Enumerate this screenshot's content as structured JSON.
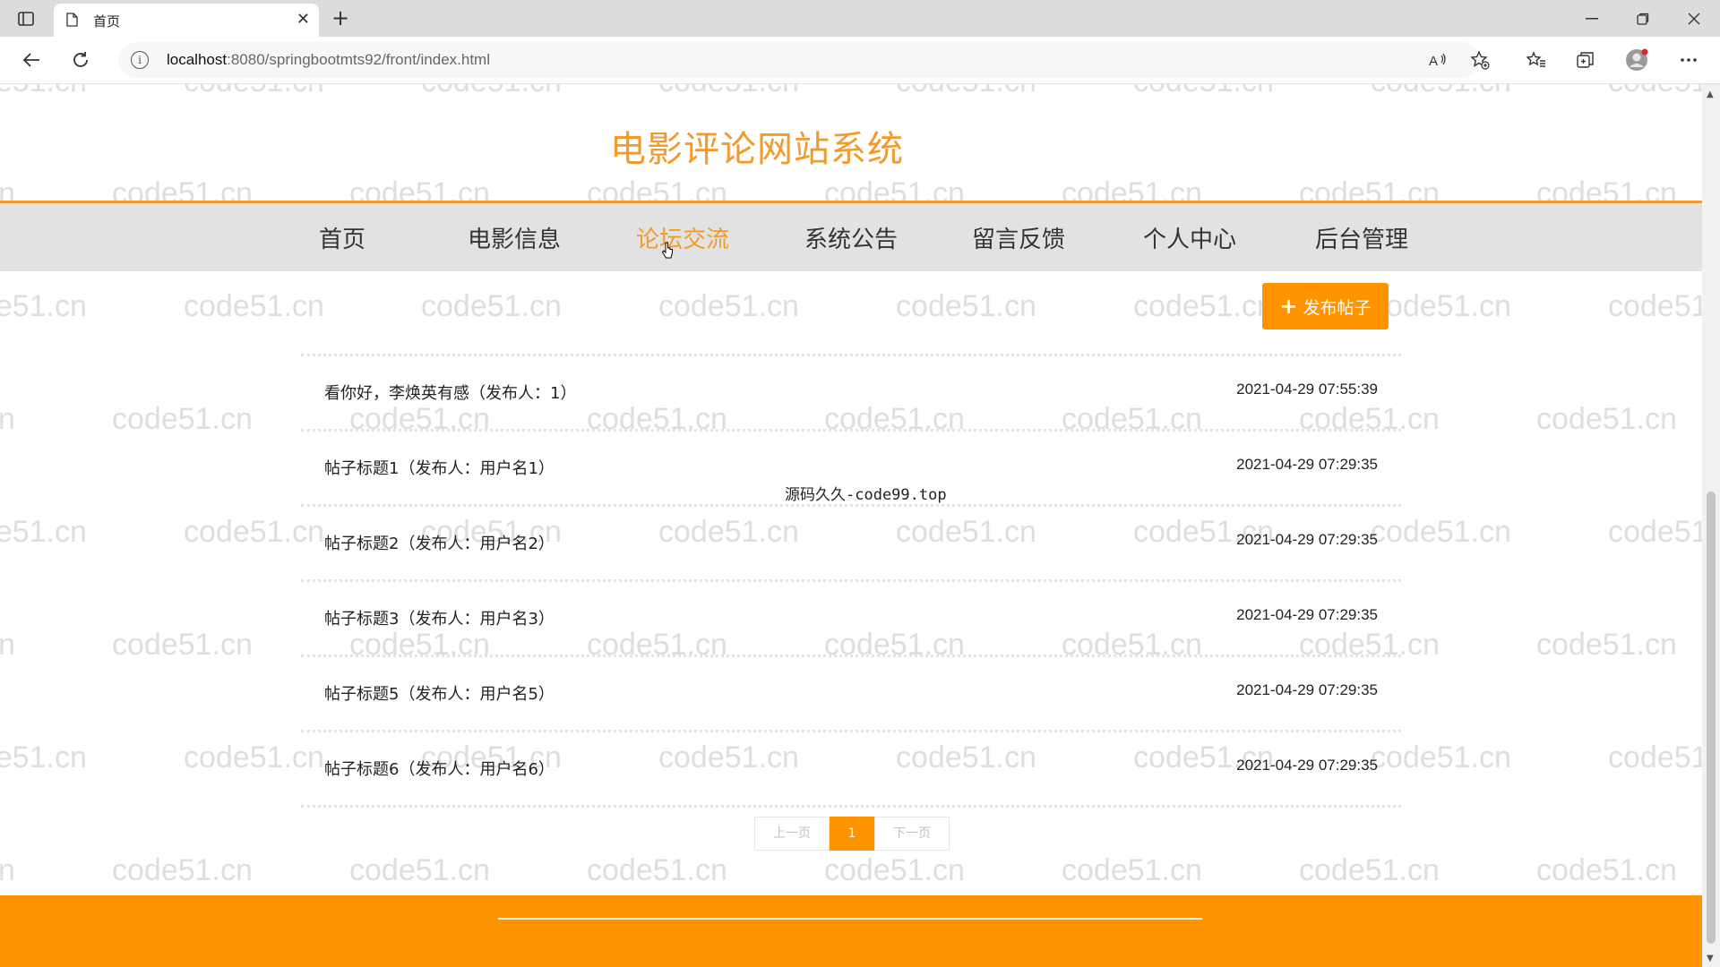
{
  "browser": {
    "tab_title": "首页",
    "url_host": "localhost",
    "url_rest": ":8080/springbootmts92/front/index.html"
  },
  "page": {
    "site_title": "电影评论网站系统",
    "watermark_text": "code51.cn",
    "nav": [
      {
        "label": "首页",
        "active": false
      },
      {
        "label": "电影信息",
        "active": false
      },
      {
        "label": "论坛交流",
        "active": true
      },
      {
        "label": "系统公告",
        "active": false
      },
      {
        "label": "留言反馈",
        "active": false
      },
      {
        "label": "个人中心",
        "active": false
      },
      {
        "label": "后台管理",
        "active": false
      }
    ],
    "publish_button": "发布帖子",
    "posts": [
      {
        "title": "看你好，李焕英有感（发布人：1）",
        "time": "2021-04-29 07:55:39"
      },
      {
        "title": "帖子标题1（发布人：用户名1）",
        "time": "2021-04-29 07:29:35"
      },
      {
        "title": "帖子标题2（发布人：用户名2）",
        "time": "2021-04-29 07:29:35"
      },
      {
        "title": "帖子标题3（发布人：用户名3）",
        "time": "2021-04-29 07:29:35"
      },
      {
        "title": "帖子标题5（发布人：用户名5）",
        "time": "2021-04-29 07:29:35"
      },
      {
        "title": "帖子标题6（发布人：用户名6）",
        "time": "2021-04-29 07:29:35"
      }
    ],
    "center_stamp": "源码久久-code99.top",
    "pagination": {
      "prev": "上一页",
      "current": "1",
      "next": "下一页"
    }
  },
  "colors": {
    "accent": "#f39a2c",
    "button": "#ff9400",
    "nav_bg": "#e2e2e2"
  }
}
